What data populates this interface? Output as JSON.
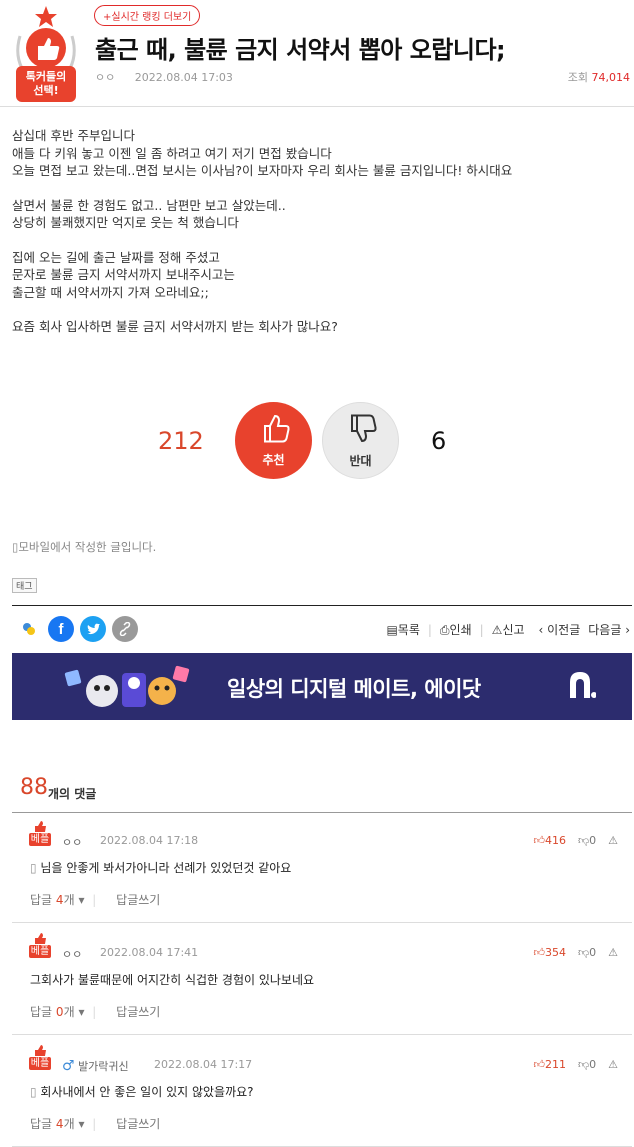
{
  "header": {
    "badge_line1": "톡커들의",
    "badge_line2": "선택!",
    "rank_link": "+실시간 랭킹 더보기",
    "title": "출근 때, 불륜 금지 서약서 뽑아 오랍니다;",
    "author": "ㅇㅇ",
    "date": "2022.08.04 17:03",
    "views_label": "조회",
    "views": "74,014"
  },
  "body": {
    "paragraphs": [
      "삼십대 후반 주부입니다\n애들 다 키워 놓고 이젠 일 좀 하려고 여기 저기 면접 봤습니다\n오늘 면접 보고 왔는데..면접 보시는 이사님?이 보자마자 우리 회사는 불륜 금지입니다! 하시대요",
      "살면서 불륜 한 경험도 없고.. 남편만 보고 살았는데..\n상당히 불쾌했지만 억지로 웃는 척 했습니다",
      "집에 오는 길에 출근 날짜를 정해 주셨고\n문자로 불륜 금지 서약서까지 보내주시고는\n출근할 때 서약서까지 가져 오라네요;;",
      "요즘 회사 입사하면 불륜 금지 서약서까지 받는 회사가 많나요?"
    ]
  },
  "votes": {
    "up_count": "212",
    "up_label": "추천",
    "down_label": "반대",
    "down_count": "6"
  },
  "mobile_note": "모바일에서 작성한 글입니다.",
  "tag_label": "태그",
  "nav": {
    "list": "목록",
    "print": "인쇄",
    "report": "신고",
    "prev": "‹ 이전글",
    "next": "다음글 ›"
  },
  "banner": {
    "text": "일상의 디지털 메이트, 에이닷"
  },
  "comments_section": {
    "count": "88",
    "label": "개의 댓글",
    "best_label": "베플",
    "reply_prefix": "답글",
    "reply_suffix": "개",
    "write_label": "답글쓰기"
  },
  "comments": [
    {
      "author": "ㅇㅇ",
      "date": "2022.08.04 17:18",
      "text": "님을 안좋게 봐서가아니라 선례가 있었던것 같아요",
      "up": "416",
      "down": "0",
      "replies": "4"
    },
    {
      "author": "ㅇㅇ",
      "date": "2022.08.04 17:41",
      "text": "그회사가 불륜때문에 어지간히 식겁한 경험이 있나보네요",
      "up": "354",
      "down": "0",
      "replies": "0"
    },
    {
      "author": "발가락귀신",
      "date": "2022.08.04 17:17",
      "text": "회사내에서 안 좋은 일이 있지 않았을까요?",
      "up": "211",
      "down": "0",
      "replies": "4"
    }
  ],
  "colors": {
    "accent": "#e8422d",
    "banner_bg": "#2c2c6e"
  }
}
